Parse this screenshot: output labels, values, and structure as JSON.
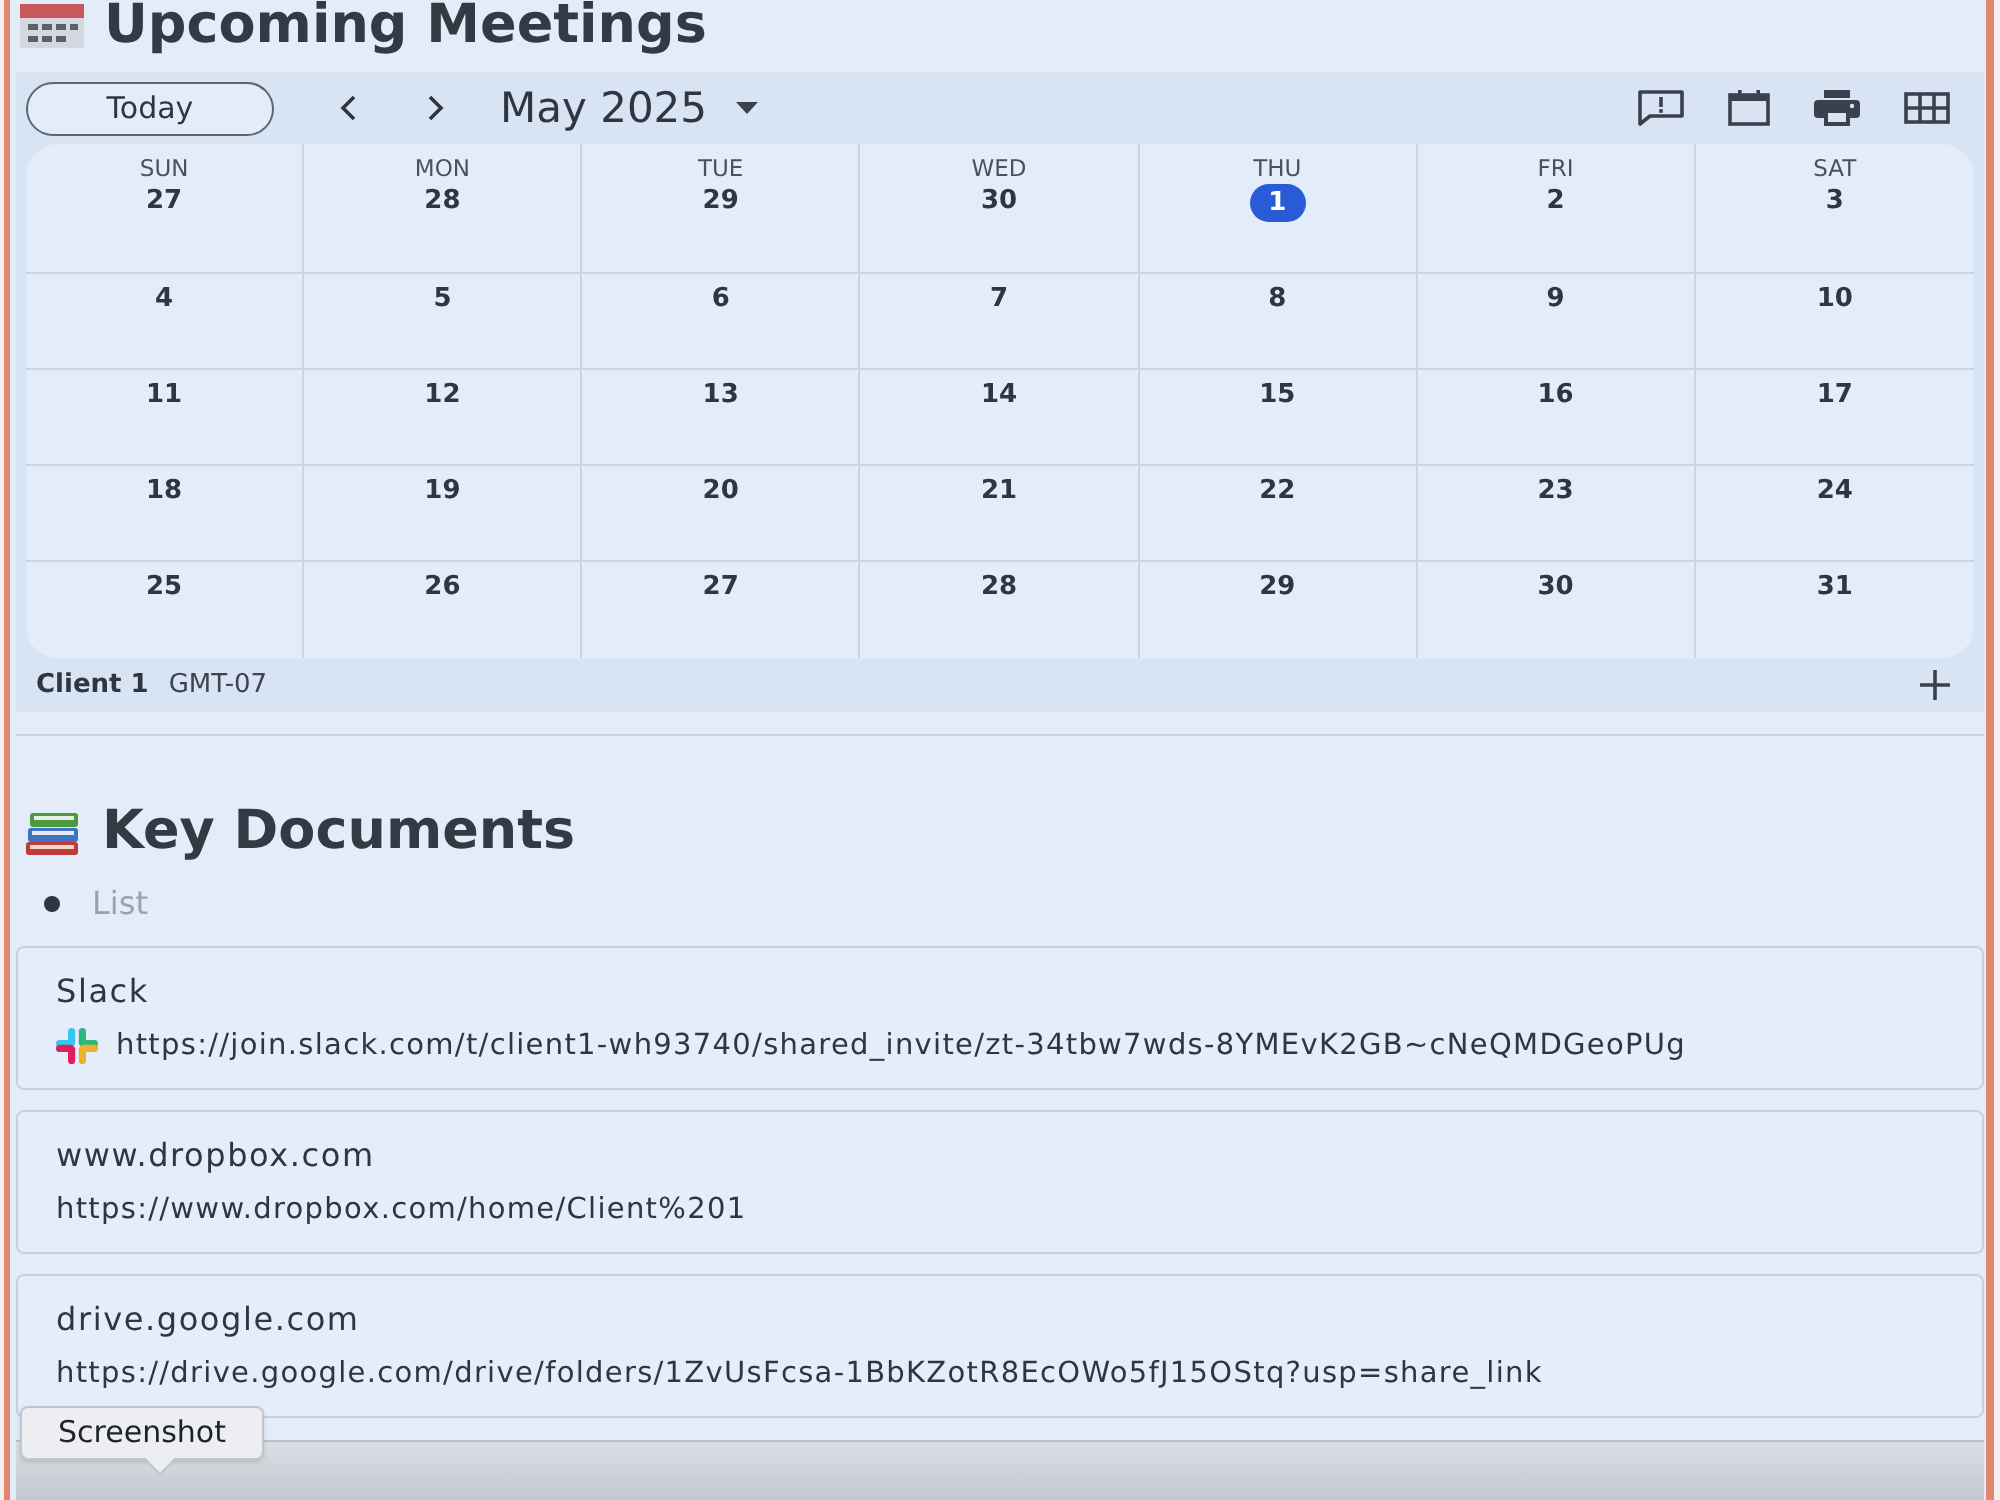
{
  "header": {
    "title": "Upcoming Meetings"
  },
  "calendar": {
    "today_button": "Today",
    "month_label": "May 2025",
    "weekdays": [
      "SUN",
      "MON",
      "TUE",
      "WED",
      "THU",
      "FRI",
      "SAT"
    ],
    "weeks": [
      {
        "days": [
          {
            "day": "27",
            "today": false
          },
          {
            "day": "28",
            "today": false
          },
          {
            "day": "29",
            "today": false
          },
          {
            "day": "30",
            "today": false
          },
          {
            "day": "1",
            "today": true
          },
          {
            "day": "2",
            "today": false
          },
          {
            "day": "3",
            "today": false
          }
        ]
      },
      {
        "days": [
          {
            "day": "4",
            "today": false
          },
          {
            "day": "5",
            "today": false
          },
          {
            "day": "6",
            "today": false
          },
          {
            "day": "7",
            "today": false
          },
          {
            "day": "8",
            "today": false
          },
          {
            "day": "9",
            "today": false
          },
          {
            "day": "10",
            "today": false
          }
        ]
      },
      {
        "days": [
          {
            "day": "11",
            "today": false
          },
          {
            "day": "12",
            "today": false
          },
          {
            "day": "13",
            "today": false
          },
          {
            "day": "14",
            "today": false
          },
          {
            "day": "15",
            "today": false
          },
          {
            "day": "16",
            "today": false
          },
          {
            "day": "17",
            "today": false
          }
        ]
      },
      {
        "days": [
          {
            "day": "18",
            "today": false
          },
          {
            "day": "19",
            "today": false
          },
          {
            "day": "20",
            "today": false
          },
          {
            "day": "21",
            "today": false
          },
          {
            "day": "22",
            "today": false
          },
          {
            "day": "23",
            "today": false
          },
          {
            "day": "24",
            "today": false
          }
        ]
      },
      {
        "days": [
          {
            "day": "25",
            "today": false
          },
          {
            "day": "26",
            "today": false
          },
          {
            "day": "27",
            "today": false
          },
          {
            "day": "28",
            "today": false
          },
          {
            "day": "29",
            "today": false
          },
          {
            "day": "30",
            "today": false
          },
          {
            "day": "31",
            "today": false
          }
        ]
      }
    ],
    "calendar_name": "Client 1",
    "timezone": "GMT-07"
  },
  "documents_section": {
    "title": "Key Documents",
    "list_item": {
      "placeholder": "List"
    }
  },
  "documents": [
    {
      "title": "Slack",
      "url": "https://join.slack.com/t/client1-wh93740/shared_invite/zt-34tbw7wds-8YMEvK2GB~cNeQMDGeoPUg",
      "logo": true
    },
    {
      "title": "www.dropbox.com",
      "url": "https://www.dropbox.com/home/Client%201",
      "logo": false
    },
    {
      "title": "drive.google.com",
      "url": "https://drive.google.com/drive/folders/1ZvUsFcsa-1BbKZotR8EcOWo5fJ15OStq?usp=share_link",
      "logo": false
    }
  ],
  "tooltip": {
    "text": "Screenshot"
  }
}
